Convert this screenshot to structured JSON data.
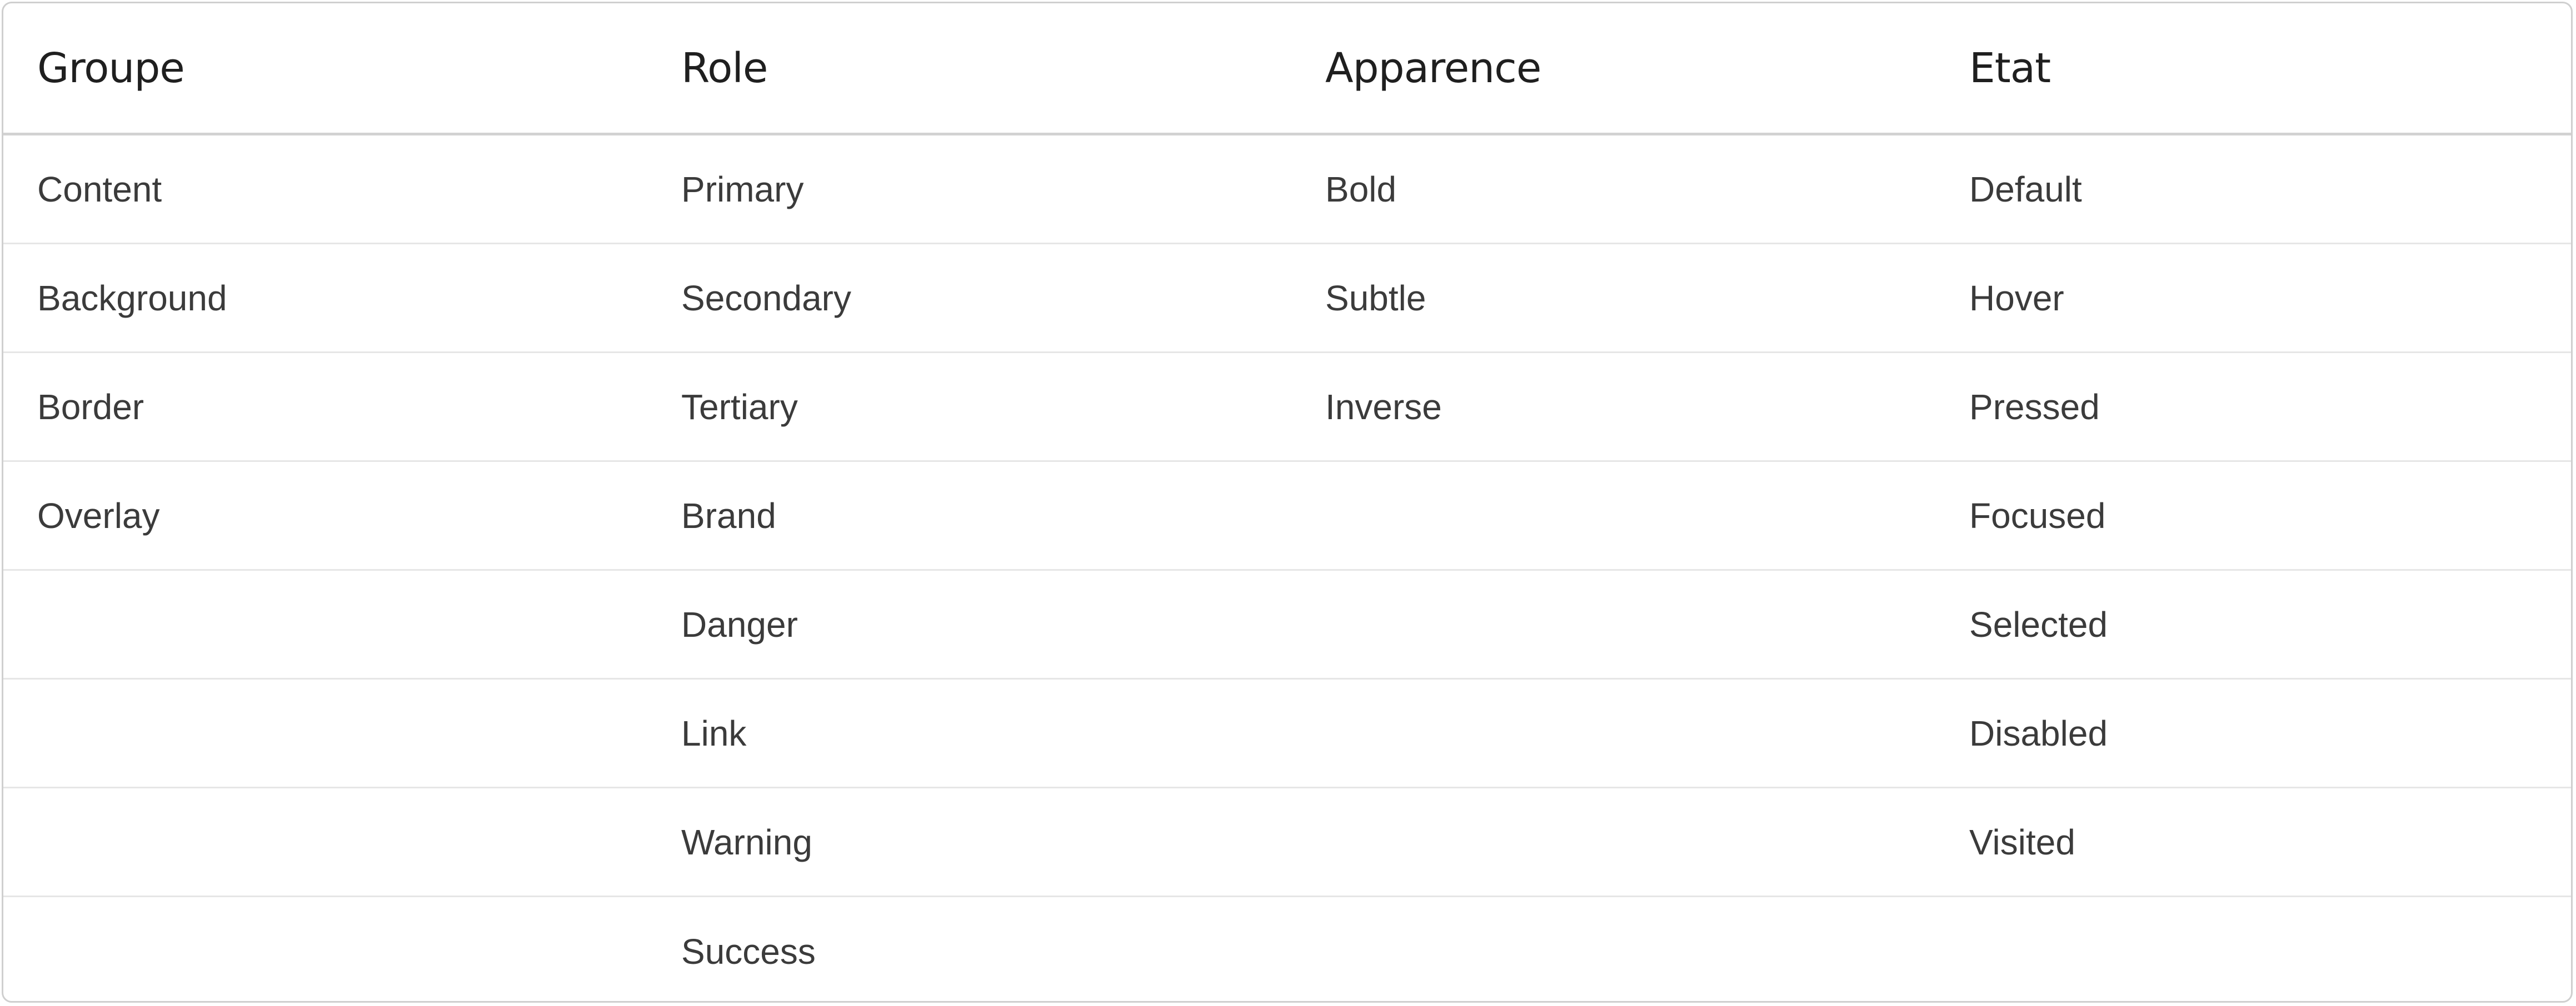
{
  "table": {
    "headers": [
      "Groupe",
      "Role",
      "Apparence",
      "Etat"
    ],
    "rows": [
      [
        "Content",
        "Primary",
        "Bold",
        "Default"
      ],
      [
        "Background",
        "Secondary",
        "Subtle",
        "Hover"
      ],
      [
        "Border",
        "Tertiary",
        "Inverse",
        "Pressed"
      ],
      [
        "Overlay",
        "Brand",
        "",
        "Focused"
      ],
      [
        "",
        "Danger",
        "",
        "Selected"
      ],
      [
        "",
        "Link",
        "",
        "Disabled"
      ],
      [
        "",
        "Warning",
        "",
        "Visited"
      ],
      [
        "",
        "Success",
        "",
        ""
      ]
    ]
  },
  "colors": {
    "border": "#cfcfcf",
    "header_text": "#1f1f1f",
    "body_text": "#3b3b3b",
    "row_divider": "#e6e6e6"
  }
}
